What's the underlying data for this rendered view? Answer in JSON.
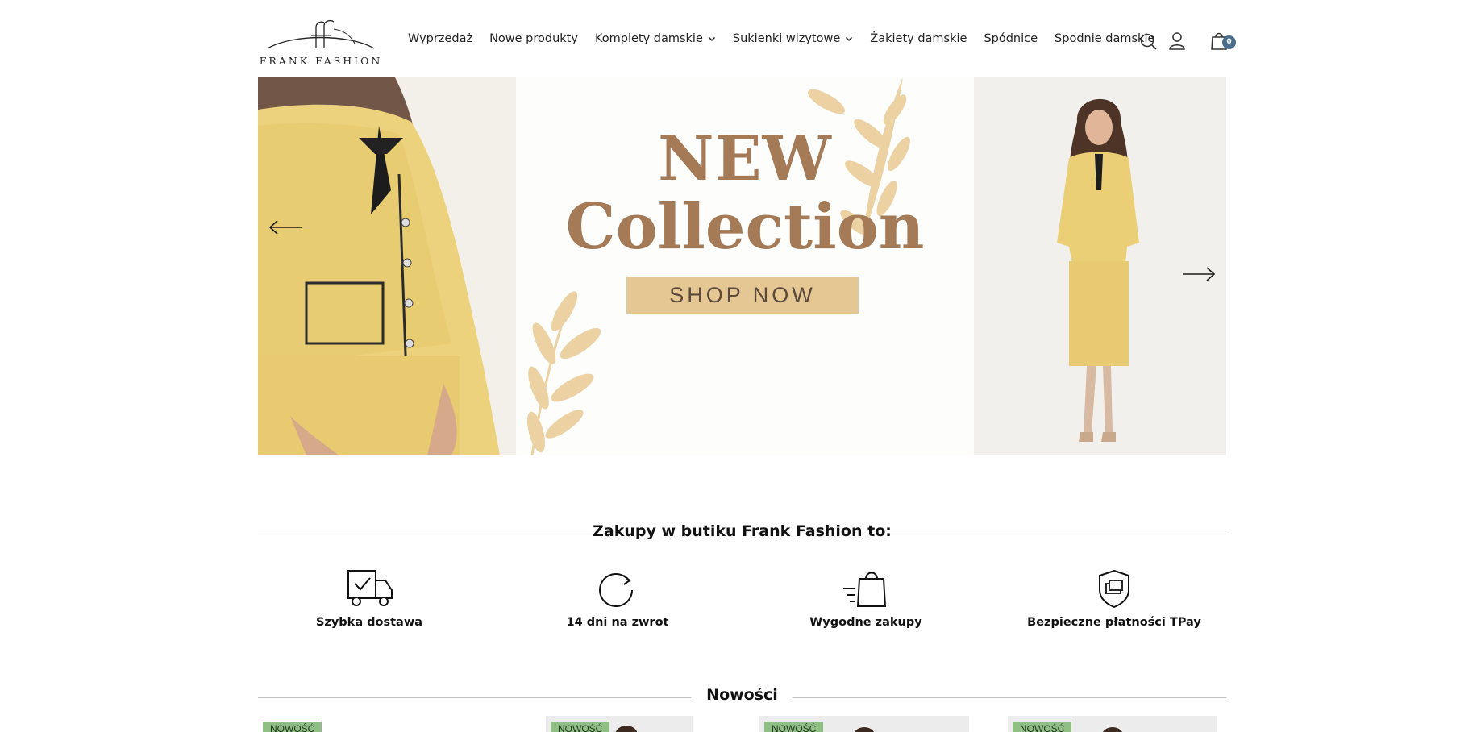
{
  "brand": {
    "name": "FRANK FASHION"
  },
  "nav": {
    "items": [
      {
        "label": "Wyprzedaż",
        "dropdown": false
      },
      {
        "label": "Nowe produkty",
        "dropdown": false
      },
      {
        "label": "Komplety damskie",
        "dropdown": true
      },
      {
        "label": "Sukienki wizytowe",
        "dropdown": true
      },
      {
        "label": "Żakiety damskie",
        "dropdown": false
      },
      {
        "label": "Spódnice",
        "dropdown": false
      },
      {
        "label": "Spodnie damskie",
        "dropdown": false
      }
    ]
  },
  "header_icons": {
    "search": "search-icon",
    "account": "user-icon",
    "cart": "shopping-bag-icon",
    "cart_count": "0"
  },
  "hero": {
    "headline_line1": "NEW",
    "headline_line2": "Collection",
    "cta_label": "SHOP NOW",
    "accent_color": "#a57a57",
    "button_color": "#e5c793"
  },
  "benefits": {
    "title": "Zakupy w butiku Frank Fashion to:",
    "items": [
      {
        "label": "Szybka dostawa",
        "icon": "delivery-truck-icon"
      },
      {
        "label": "14 dni na zwrot",
        "icon": "return-arrow-icon"
      },
      {
        "label": "Wygodne zakupy",
        "icon": "shopping-bag-fast-icon"
      },
      {
        "label": "Bezpieczne płatności TPay",
        "icon": "secure-payment-shield-icon"
      }
    ]
  },
  "new_products": {
    "title": "Nowości",
    "badges": [
      "NOWOŚĆ",
      "NOWOŚĆ",
      "NOWOŚĆ",
      "NOWOŚĆ"
    ],
    "badge_color": "#8fbf84"
  }
}
